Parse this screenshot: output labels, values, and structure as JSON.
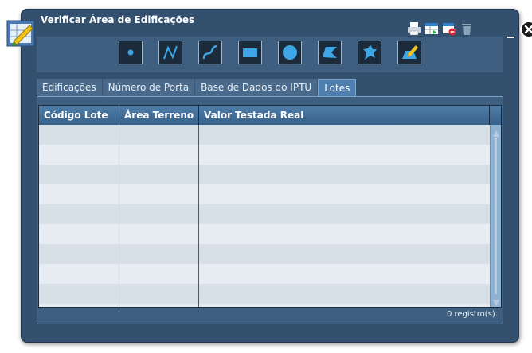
{
  "window": {
    "title": "Verificar Área de Edificações"
  },
  "window_icons": [
    {
      "name": "print-icon"
    },
    {
      "name": "export-table-icon"
    },
    {
      "name": "clear-selection-icon"
    },
    {
      "name": "trash-icon"
    }
  ],
  "controls": {
    "minimize": "minimize-icon",
    "close": "close-icon"
  },
  "drawing_tools": [
    "point-tool-icon",
    "line-tool-icon",
    "curve-tool-icon",
    "rectangle-tool-icon",
    "circle-tool-icon",
    "polygon-tool-icon",
    "freehand-shape-tool-icon",
    "edit-tool-icon"
  ],
  "tabs": [
    {
      "label": "Edificações",
      "active": false
    },
    {
      "label": "Número de Porta",
      "active": false
    },
    {
      "label": "Base de Dados do IPTU",
      "active": false
    },
    {
      "label": "Lotes",
      "active": true
    }
  ],
  "table": {
    "columns": [
      "Código Lote",
      "Área Terreno",
      "Valor Testada Real"
    ],
    "rows": []
  },
  "footer": {
    "record_count": "0 registro(s)."
  },
  "colors": {
    "window": "#33506e",
    "header": "#36618a",
    "accent": "#3e8ec6"
  }
}
